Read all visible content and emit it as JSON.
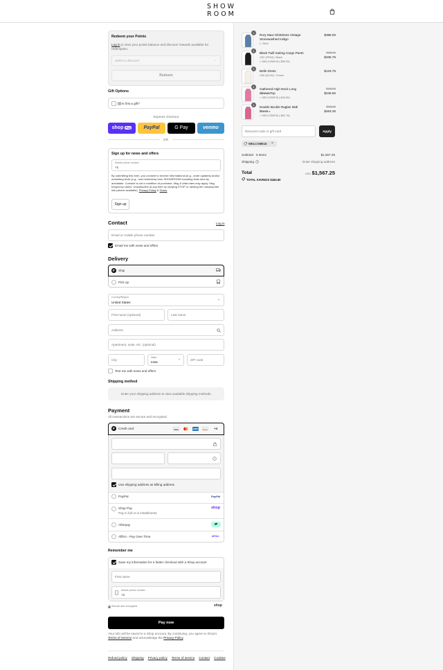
{
  "header": {
    "logo_line1": "SHOW",
    "logo_line2": "ROOM",
    "bag_icon": "shopping-bag-icon"
  },
  "points": {
    "title": "Redeem your Points",
    "login_link": "Log in",
    "desc": " to view your points balance and discover rewards available for redemption.",
    "select_placeholder": "Select a discount",
    "redeem_label": "Redeem"
  },
  "gift": {
    "title": "Gift Options",
    "label": "Is this a gift?"
  },
  "express": {
    "label": "Express checkout",
    "shop": "shop",
    "shop_pay": "Pay",
    "paypal": "PayPal",
    "gpay": "G Pay",
    "venmo": "venmo",
    "or": "OR"
  },
  "signup": {
    "title": "Sign up for news and offers",
    "phone_label": "Mobile phone number",
    "phone_value": "+1",
    "consent": "By submitting this form, you consent to receive informational (e.g., order updates) and/or marketing texts (e.g., cart reminders) from SHOWROOM including texts sent by autodialer. Consent is not a condition of purchase. Msg & data rates may apply. Msg frequency varies. Unsubscribe at any time by replying STOP or clicking the unsubscribe link (where available).",
    "privacy": "Privacy Policy",
    "amp": " & ",
    "terms": "Terms",
    "button": "Sign up"
  },
  "contact": {
    "title": "Contact",
    "login": "Log in",
    "placeholder": "Email or mobile phone number",
    "email_offers": "Email me with news and offers"
  },
  "delivery": {
    "title": "Delivery",
    "ship": "Ship",
    "pickup": "Pick up",
    "country_label": "Country/Region",
    "country": "United States",
    "first_name": "First name (optional)",
    "last_name": "Last name",
    "address": "Address",
    "apartment": "Apartment, suite, etc. (optional)",
    "city": "City",
    "state_label": "State",
    "state": "Iowa",
    "zip": "ZIP code",
    "text_offers": "Text me with news and offers"
  },
  "shipping_method": {
    "title": "Shipping method",
    "message": "Enter your shipping address to view available shipping methods."
  },
  "payment": {
    "title": "Payment",
    "subtitle": "All transactions are secure and encrypted.",
    "credit_card": "Credit card",
    "cards": [
      "VISA",
      "MC",
      "AMEX",
      "DISC"
    ],
    "more": "+4",
    "billing_same": "Use shipping address as billing address",
    "paypal": "PayPal",
    "paypal_logo": "PayPal",
    "shop_pay": "Shop Pay",
    "shop_pay_sub": "Pay in full or in installments",
    "shop_logo": "shop",
    "afterpay": "Afterpay",
    "affirm": "Affirm - Pay Over Time",
    "affirm_logo": "affirm"
  },
  "remember": {
    "title": "Remember me",
    "save_info": "Save my information for a faster checkout with a Shop account",
    "first_name": "First name",
    "phone_label": "Mobile phone number",
    "phone_value": "+1",
    "secure": "Secure and encrypted",
    "shop_logo": "shop"
  },
  "pay_now": "Pay now",
  "shop_notice": {
    "text": "Your info will be saved to a Shop account. By continuing, you agree to Shop's ",
    "tos": "Terms of Service",
    "and": " and acknowledge the ",
    "privacy": "Privacy Policy",
    "end": "."
  },
  "footer_links": [
    "Refund policy",
    "Shipping",
    "Privacy policy",
    "Terms of service",
    "Contact",
    "Cookies"
  ],
  "cart": {
    "items": [
      {
        "qty": "1",
        "name": "Rory Maxi Shirtdress Vintage Stonewashed Indigo",
        "variant": "L / Blue",
        "discount": "",
        "orig_price": "",
        "price": "$388.00",
        "color": "#5b7fa6"
      },
      {
        "qty": "1",
        "name": "Black Twill Suiting Cargo Pants",
        "variant": "US2 (FR34) / Black",
        "discount": "WELCOME15 (-$59.25)",
        "orig_price": "$395.00",
        "price": "$335.75",
        "color": "#1b1b1b"
      },
      {
        "qty": "1",
        "name": "Belle Dress",
        "variant": "US8 (AU10) / Cream",
        "discount": "",
        "orig_price": "",
        "price": "$123.75",
        "color": "#f4f0e8"
      },
      {
        "qty": "1",
        "name": "Gathered High Neck Long Sleeve Top",
        "variant": "XS / Pink",
        "discount": "WELCOME15 (-$43.50)",
        "orig_price": "$290.00",
        "price": "$246.50",
        "color": "#e07aa0"
      },
      {
        "qty": "1",
        "name": "Double Buckle Raglan Midi Dress",
        "variant": "XS / Pink",
        "discount": "WELCOME15 (-$81.75)",
        "orig_price": "$545.00",
        "price": "$463.25",
        "color": "#d96590"
      }
    ],
    "discount_placeholder": "Discount code or gift card",
    "apply": "Apply",
    "applied_code": "WELCOME15",
    "subtotal_label": "Subtotal · 5 items",
    "subtotal": "$1,567.25",
    "shipping_label": "Shipping",
    "shipping_value": "Enter shipping address",
    "total_label": "Total",
    "currency": "USD",
    "total": "$1,567.25",
    "savings_label": "TOTAL SAVINGS",
    "savings": "$184.50"
  }
}
